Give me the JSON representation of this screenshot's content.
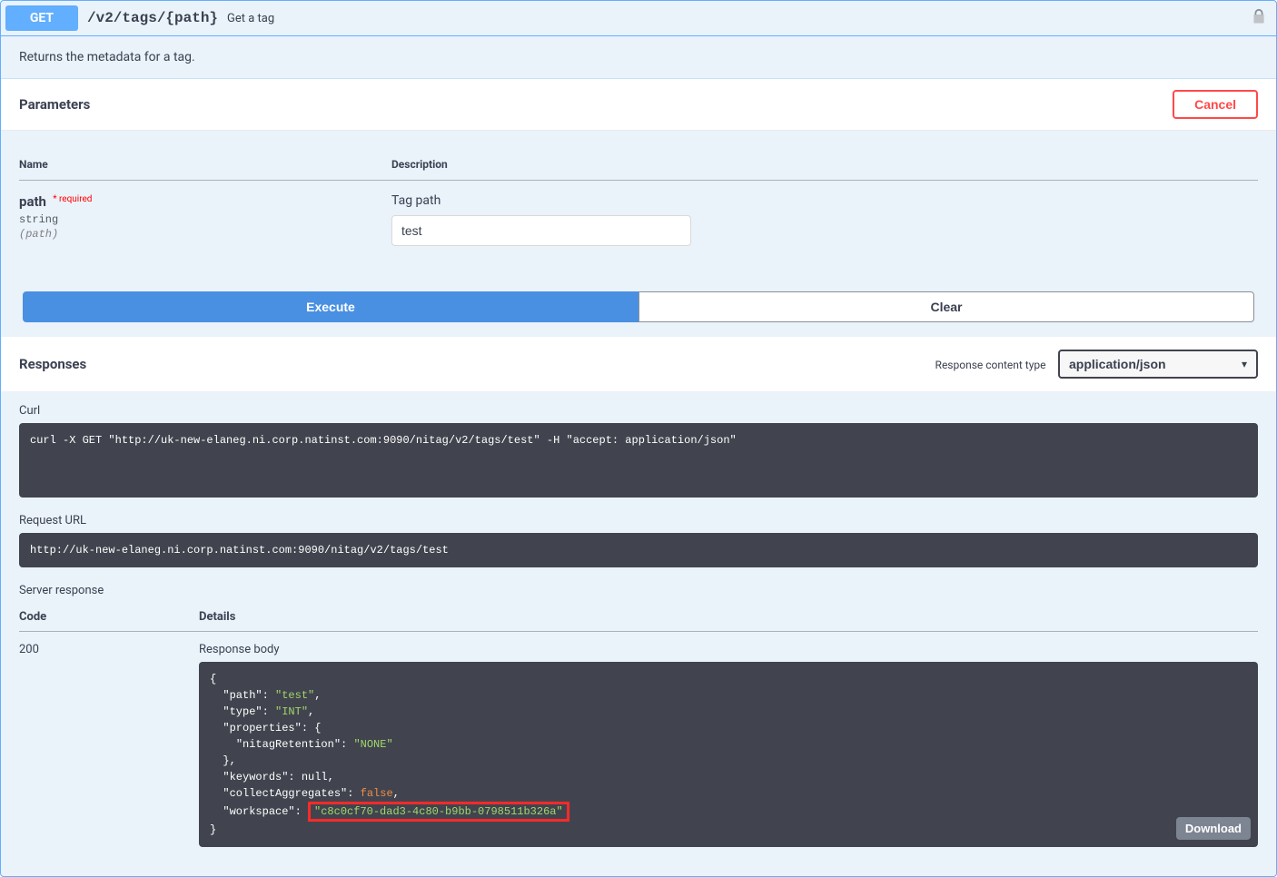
{
  "op": {
    "method": "GET",
    "path": "/v2/tags/{path}",
    "summary": "Get a tag",
    "description": "Returns the metadata for a tag."
  },
  "parameters": {
    "title": "Parameters",
    "cancel_label": "Cancel",
    "col_name": "Name",
    "col_desc": "Description",
    "rows": [
      {
        "name": "path",
        "required_label": "* required",
        "type": "string",
        "in": "(path)",
        "desc": "Tag path",
        "value": "test"
      }
    ]
  },
  "buttons": {
    "execute": "Execute",
    "clear": "Clear"
  },
  "responses": {
    "title": "Responses",
    "ct_label": "Response content type",
    "ct_value": "application/json",
    "curl_label": "Curl",
    "curl_cmd": "curl -X GET \"http://uk-new-elaneg.ni.corp.natinst.com:9090/nitag/v2/tags/test\" -H \"accept: application/json\"",
    "req_url_label": "Request URL",
    "req_url": "http://uk-new-elaneg.ni.corp.natinst.com:9090/nitag/v2/tags/test",
    "server_resp_label": "Server response",
    "code_header": "Code",
    "details_header": "Details",
    "code": "200",
    "body_label": "Response body",
    "download_label": "Download",
    "body_json": {
      "path": "test",
      "type": "INT",
      "properties": {
        "nitagRetention": "NONE"
      },
      "keywords": null,
      "collectAggregates": false,
      "workspace": "c8c0cf70-dad3-4c80-b9bb-0798511b326a"
    }
  }
}
